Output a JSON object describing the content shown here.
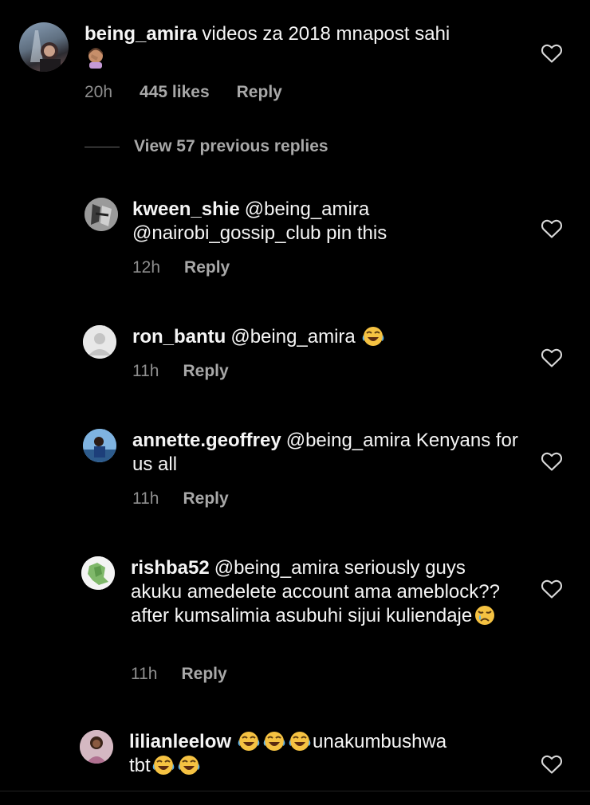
{
  "main_comment": {
    "username": "being_amira",
    "text": "videos za 2018 mnapost sahi",
    "emoji": "🤦🏽‍♀️",
    "time": "20h",
    "likes": "445 likes",
    "reply_label": "Reply"
  },
  "view_replies": {
    "label": "View 57 previous replies"
  },
  "replies": [
    {
      "username": "kween_shie",
      "text": "@being_amira @nairobi_gossip_club  pin this",
      "time": "12h",
      "reply_label": "Reply"
    },
    {
      "username": "ron_bantu",
      "text": "@being_amira",
      "time": "11h",
      "reply_label": "Reply"
    },
    {
      "username": "annette.geoffrey",
      "text": "@being_amira Kenyans for us all",
      "time": "11h",
      "reply_label": "Reply"
    },
    {
      "username": "rishba52",
      "text": "@being_amira seriously guys akuku amedelete account ama ameblock??after kumsalimia asubuhi sijui kuliendaje",
      "time": "11h",
      "reply_label": "Reply"
    },
    {
      "username": "lilianleelow",
      "text_after_emojis": "unakumbushwa",
      "text_line2": "tbt"
    }
  ],
  "icons": {
    "heart": "heart-outline-icon",
    "laugh": "face-with-tears-of-joy-emoji",
    "cry": "crying-face-emoji"
  },
  "colors": {
    "background": "#000000",
    "text": "#f5f5f5",
    "meta": "#a8a8a8"
  }
}
